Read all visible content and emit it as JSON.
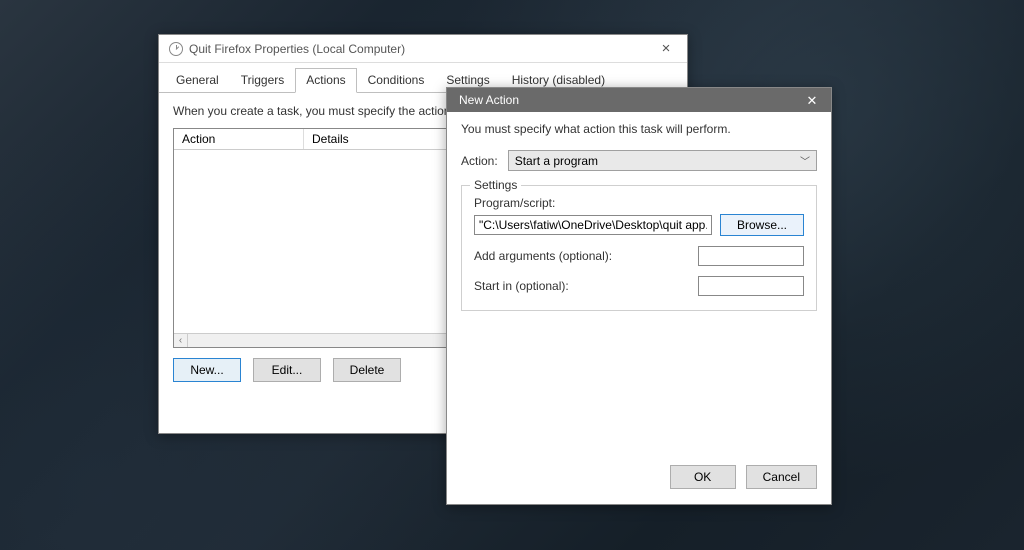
{
  "properties": {
    "title": "Quit Firefox Properties (Local Computer)",
    "tabs": {
      "general": "General",
      "triggers": "Triggers",
      "actions": "Actions",
      "conditions": "Conditions",
      "settings": "Settings",
      "history": "History (disabled)"
    },
    "instruction": "When you create a task, you must specify the action that will",
    "columns": {
      "action": "Action",
      "details": "Details"
    },
    "buttons": {
      "new_": "New...",
      "edit": "Edit...",
      "delete": "Delete"
    }
  },
  "new_action": {
    "title": "New Action",
    "must": "You must specify what action this task will perform.",
    "action_label": "Action:",
    "action_value": "Start a program",
    "settings_legend": "Settings",
    "program_label": "Program/script:",
    "program_value": "\"C:\\Users\\fatiw\\OneDrive\\Desktop\\quit app.bat\"",
    "browse": "Browse...",
    "args_label": "Add arguments (optional):",
    "args_value": "",
    "startin_label": "Start in (optional):",
    "startin_value": "",
    "ok": "OK",
    "cancel": "Cancel"
  }
}
